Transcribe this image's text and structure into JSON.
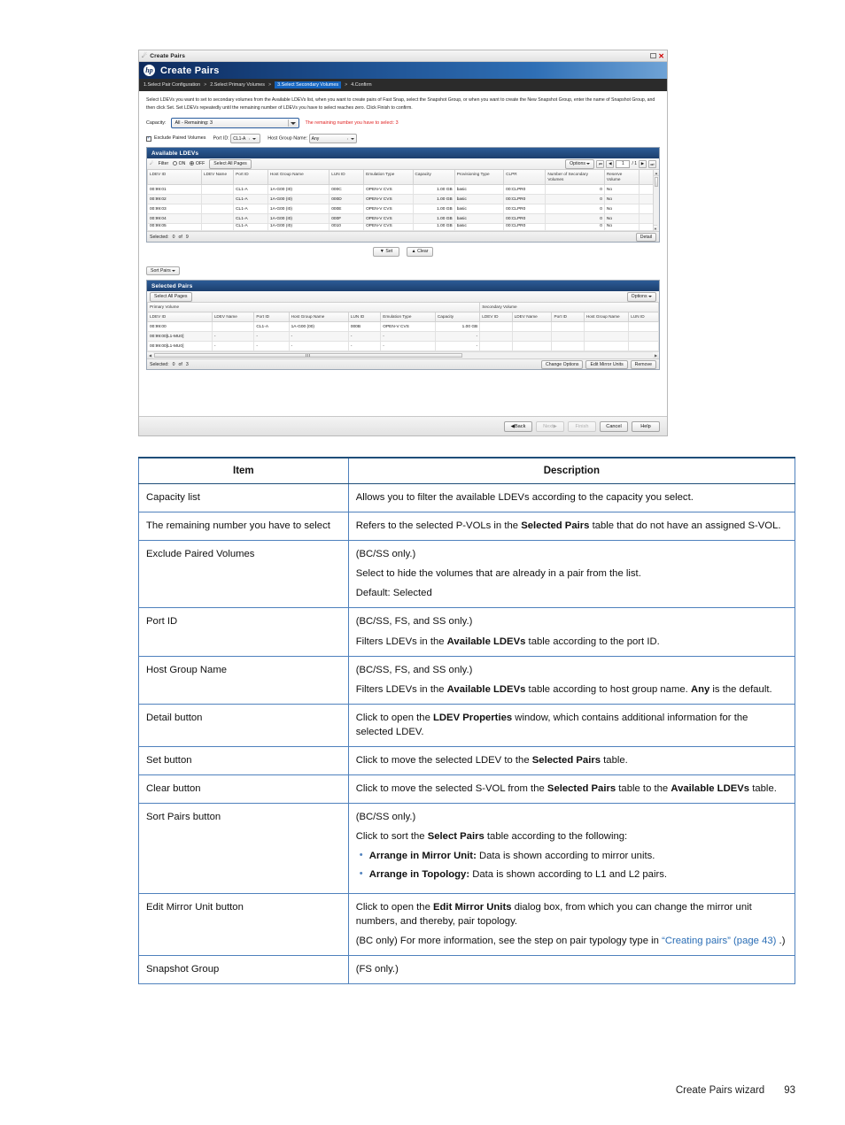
{
  "screenshot": {
    "window_titlebar": {
      "icon": "wizard-icon",
      "title": "Create Pairs",
      "minimize": "minimize",
      "close": "✕"
    },
    "hp_band": {
      "logo": "hp",
      "title": "Create Pairs"
    },
    "breadcrumb": {
      "steps": [
        {
          "label": "1.Select Pair Configuration",
          "active": false
        },
        {
          "label": "2.Select Primary Volumes",
          "active": false
        },
        {
          "label": "3.Select Secondary Volumes",
          "active": true
        },
        {
          "label": "4.Confirm",
          "active": false
        }
      ],
      "separator": ">"
    },
    "instruction": "Select LDEVs you want to set to secondary volumes from the Available LDEVs list, when you want to create pairs of Fast Snap, select the Snapshot Group, or when you want to create the New Snapshot Group, enter the name of Snapshot Group, and then click Set. Set LDEVs repeatedly until the remaining number of LDEVs you have to select reaches zero. Click Finish to confirm.",
    "capacity": {
      "label": "Capacity:",
      "value": "All - Remaining: 3",
      "remaining_message": "The remaining number you have to select:  3"
    },
    "filters": {
      "exclude_paired_volumes": {
        "label": "Exclude Paired Volumes",
        "checked": true,
        "check_glyph": "✓"
      },
      "port_id": {
        "label": "Port ID:",
        "value": "CL1-A"
      },
      "host_group_name": {
        "label": "Host Group Name:",
        "value": "Any"
      }
    },
    "available_ldevs": {
      "title": "Available LDEVs",
      "toolbar": {
        "filter_label": "Filter",
        "on_label": "ON",
        "off_label": "OFF",
        "filter_state": "OFF",
        "select_all_pages": "Select All Pages",
        "options": "Options",
        "page_value": "1",
        "page_total": "/ 1",
        "first_glyph": "⏮",
        "prev_glyph": "◀◀",
        "next_glyph": "▶▶",
        "last_glyph": "⏭"
      },
      "columns": [
        "LDEV ID",
        "LDEV Name",
        "Port ID",
        "Host Group Name",
        "LUN ID",
        "Emulation Type",
        "Capacity",
        "Provisioning Type",
        "CLPR",
        "Number of Secondary Volumes",
        "Reserve Volume",
        ""
      ],
      "rows": [
        {
          "ldev_id": "00:99:01",
          "ldev_name": "",
          "port_id": "CL1-A",
          "host_group_name": "1A-G00 (I0)",
          "lun_id": "000C",
          "emulation_type": "OPEN-V CVS",
          "capacity": "1.00 GB",
          "provisioning_type": "basic",
          "clpr": "00:CLPR0",
          "num_secondary": "0",
          "reserve_volume": "No"
        },
        {
          "ldev_id": "00:99:02",
          "ldev_name": "",
          "port_id": "CL1-A",
          "host_group_name": "1A-G00 (I0)",
          "lun_id": "000D",
          "emulation_type": "OPEN-V CVS",
          "capacity": "1.00 GB",
          "provisioning_type": "basic",
          "clpr": "00:CLPR0",
          "num_secondary": "0",
          "reserve_volume": "No"
        },
        {
          "ldev_id": "00:99:03",
          "ldev_name": "",
          "port_id": "CL1-A",
          "host_group_name": "1A-G00 (I0)",
          "lun_id": "000E",
          "emulation_type": "OPEN-V CVS",
          "capacity": "1.00 GB",
          "provisioning_type": "basic",
          "clpr": "00:CLPR0",
          "num_secondary": "0",
          "reserve_volume": "No"
        },
        {
          "ldev_id": "00:99:04",
          "ldev_name": "",
          "port_id": "CL1-A",
          "host_group_name": "1A-G00 (I0)",
          "lun_id": "000F",
          "emulation_type": "OPEN-V CVS",
          "capacity": "1.00 GB",
          "provisioning_type": "basic",
          "clpr": "00:CLPR0",
          "num_secondary": "0",
          "reserve_volume": "No"
        },
        {
          "ldev_id": "00:99:05",
          "ldev_name": "",
          "port_id": "CL1-A",
          "host_group_name": "1A-G00 (I0)",
          "lun_id": "0010",
          "emulation_type": "OPEN-V CVS",
          "capacity": "1.00 GB",
          "provisioning_type": "basic",
          "clpr": "00:CLPR0",
          "num_secondary": "0",
          "reserve_volume": "No"
        }
      ],
      "footer": {
        "selected_label": "Selected:",
        "selected_count": "0",
        "of_label": "of",
        "total": "9",
        "detail_button": "Detail"
      }
    },
    "mid_buttons": {
      "set": "Set",
      "clear": "Clear",
      "set_glyph": "▼",
      "clear_glyph": "▲",
      "sort_pairs": "Sort Pairs"
    },
    "selected_pairs": {
      "title": "Selected Pairs",
      "toolbar": {
        "select_all_pages": "Select All Pages",
        "options": "Options"
      },
      "group_headers": {
        "primary": "Primary Volume",
        "secondary": "Secondary Volume"
      },
      "primary_columns": [
        "LDEV ID",
        "LDEV Name",
        "Port ID",
        "Host Group Name",
        "LUN ID",
        "Emulation Type",
        "Capacity"
      ],
      "secondary_columns": [
        "LDEV ID",
        "LDEV Name",
        "Port ID",
        "Host Group Name",
        "LUN ID"
      ],
      "rows": [
        {
          "p": [
            "00:99:00",
            "",
            "CL1-A",
            "1A-G00 (00)",
            "000B",
            "OPEN-V CVS",
            "1.00 GB"
          ],
          "s": [
            "",
            "",
            "",
            "",
            ""
          ]
        },
        {
          "p": [
            "00:99:00[L1-MU0]",
            "-",
            "-",
            "-",
            "-",
            "-",
            "-"
          ],
          "s": [
            "",
            "",
            "",
            "",
            ""
          ]
        },
        {
          "p": [
            "00:99:00[L1-MU0]",
            "-",
            "-",
            "-",
            "-",
            "-",
            "-"
          ],
          "s": [
            "",
            "",
            "",
            "",
            ""
          ]
        }
      ],
      "footer": {
        "selected_label": "Selected:",
        "selected_count": "0",
        "of_label": "of",
        "total": "3",
        "change_options": "Change Options",
        "edit_mirror_units": "Edit Mirror Units",
        "remove": "Remove"
      }
    },
    "wizard_footer": {
      "back": "Back",
      "next": "Next",
      "finish": "Finish",
      "cancel": "Cancel",
      "help": "Help",
      "back_glyph": "◀",
      "next_glyph": "▶"
    }
  },
  "doc_table": {
    "headers": {
      "item": "Item",
      "description": "Description"
    },
    "rows": [
      {
        "item": "Capacity list",
        "blocks": [
          {
            "type": "p",
            "parts": [
              {
                "t": "Allows you to filter the available LDEVs according to the capacity you select."
              }
            ]
          }
        ]
      },
      {
        "item": "The remaining number you have to select",
        "blocks": [
          {
            "type": "p",
            "parts": [
              {
                "t": "Refers to the selected P-VOLs in the "
              },
              {
                "t": "Selected Pairs",
                "b": true
              },
              {
                "t": " table that do not have an assigned S-VOL."
              }
            ]
          }
        ]
      },
      {
        "item": "Exclude Paired Volumes",
        "blocks": [
          {
            "type": "p",
            "parts": [
              {
                "t": "(BC/SS only.)"
              }
            ]
          },
          {
            "type": "p",
            "parts": [
              {
                "t": "Select to hide the volumes that are already in a pair from the list."
              }
            ]
          },
          {
            "type": "p",
            "parts": [
              {
                "t": "Default: Selected"
              }
            ]
          }
        ]
      },
      {
        "item": "Port ID",
        "blocks": [
          {
            "type": "p",
            "parts": [
              {
                "t": "(BC/SS, FS, and SS only.)"
              }
            ]
          },
          {
            "type": "p",
            "parts": [
              {
                "t": "Filters LDEVs in the "
              },
              {
                "t": "Available LDEVs",
                "b": true
              },
              {
                "t": " table according to the port ID."
              }
            ]
          }
        ]
      },
      {
        "item": "Host Group Name",
        "blocks": [
          {
            "type": "p",
            "parts": [
              {
                "t": "(BC/SS, FS, and SS only.)"
              }
            ]
          },
          {
            "type": "p",
            "parts": [
              {
                "t": "Filters LDEVs in the "
              },
              {
                "t": "Available LDEVs",
                "b": true
              },
              {
                "t": " table according to host group name. "
              },
              {
                "t": "Any",
                "b": true
              },
              {
                "t": " is the default."
              }
            ]
          }
        ]
      },
      {
        "item": "Detail button",
        "blocks": [
          {
            "type": "p",
            "parts": [
              {
                "t": "Click to open the "
              },
              {
                "t": "LDEV Properties",
                "b": true
              },
              {
                "t": " window, which contains additional information for the selected LDEV."
              }
            ]
          }
        ]
      },
      {
        "item": "Set button",
        "blocks": [
          {
            "type": "p",
            "parts": [
              {
                "t": "Click to move the selected LDEV to the "
              },
              {
                "t": "Selected Pairs",
                "b": true
              },
              {
                "t": " table."
              }
            ]
          }
        ]
      },
      {
        "item": "Clear button",
        "blocks": [
          {
            "type": "p",
            "parts": [
              {
                "t": "Click to move the selected S-VOL from the "
              },
              {
                "t": "Selected Pairs",
                "b": true
              },
              {
                "t": " table to the "
              },
              {
                "t": "Available LDEVs",
                "b": true
              },
              {
                "t": " table."
              }
            ]
          }
        ]
      },
      {
        "item": "Sort Pairs button",
        "blocks": [
          {
            "type": "p",
            "parts": [
              {
                "t": "(BC/SS only.)"
              }
            ]
          },
          {
            "type": "p",
            "parts": [
              {
                "t": "Click to sort the "
              },
              {
                "t": "Select Pairs",
                "b": true
              },
              {
                "t": " table according to the following:"
              }
            ]
          },
          {
            "type": "ul",
            "items": [
              [
                {
                  "t": "Arrange in Mirror Unit:",
                  "b": true
                },
                {
                  "t": " Data is shown according to mirror units."
                }
              ],
              [
                {
                  "t": "Arrange in Topology:",
                  "b": true
                },
                {
                  "t": " Data is shown according to L1 and L2 pairs."
                }
              ]
            ]
          }
        ]
      },
      {
        "item": "Edit Mirror Unit button",
        "blocks": [
          {
            "type": "p",
            "parts": [
              {
                "t": "Click to open the "
              },
              {
                "t": "Edit Mirror Units",
                "b": true
              },
              {
                "t": " dialog box, from which you can change the mirror unit numbers, and thereby, pair topology."
              }
            ]
          },
          {
            "type": "p",
            "parts": [
              {
                "t": "(BC only) For more information, see the step on pair typology type in "
              },
              {
                "t": "“Creating pairs” (page 43)",
                "link": true
              },
              {
                "t": " .)"
              }
            ]
          }
        ]
      },
      {
        "item": "Snapshot Group",
        "blocks": [
          {
            "type": "p",
            "parts": [
              {
                "t": "(FS only.)"
              }
            ]
          }
        ]
      }
    ]
  },
  "page_footer": {
    "section": "Create Pairs wizard",
    "page_number": "93"
  }
}
